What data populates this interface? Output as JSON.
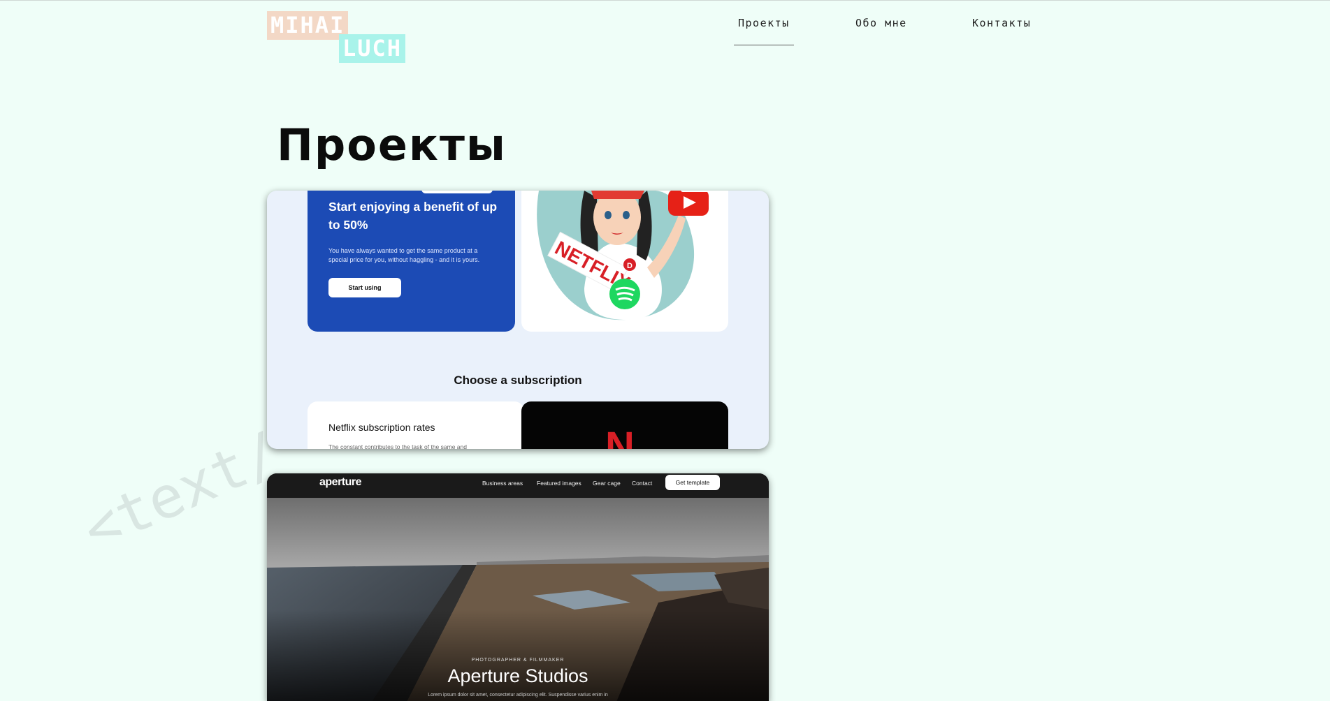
{
  "logo": {
    "line1": "MIHAI",
    "line2": "LUCH"
  },
  "nav": {
    "items": [
      {
        "label": "Проекты",
        "active": true
      },
      {
        "label": "Обо мне",
        "active": false
      },
      {
        "label": "Контакты",
        "active": false
      }
    ]
  },
  "page": {
    "title": "Проекты",
    "watermark": "<text/"
  },
  "projects": [
    {
      "promo_heading": "Start enjoying a benefit of up to 50%",
      "promo_text": "You have always wanted to get the same product at a special price for you, without haggling - and it is yours.",
      "promo_button": "Start using",
      "section_heading": "Choose a subscription",
      "rate_title": "Netflix subscription rates",
      "rate_text": "The constant contributes to the task of the same and",
      "netflix_letter": "N",
      "sticker_text": "NETFLIX"
    },
    {
      "logo": "aperture",
      "links": [
        "Business areas",
        "Featured images",
        "Gear cage",
        "Contact"
      ],
      "cta": "Get template",
      "eyebrow": "PHOTOGRAPHER & FILMMAKER",
      "title": "Aperture Studios",
      "lorem": "Lorem ipsum dolor sit amet, consectetur adipiscing elit. Suspendisse varius enim in"
    }
  ],
  "colors": {
    "background": "#effef8",
    "logo_peach": "#f3d8c6",
    "logo_mint": "#a9f3ea",
    "promo_blue": "#1c4bb5",
    "netflix_red": "#d81f26"
  }
}
